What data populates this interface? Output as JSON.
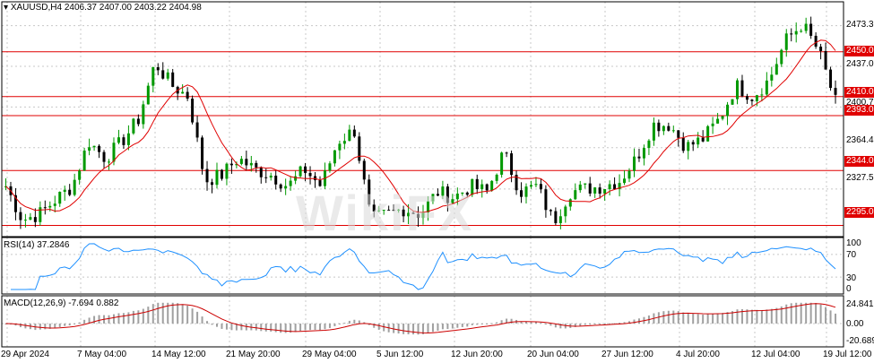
{
  "header": {
    "symbol_label": "XAUUSD,H4",
    "ohlc_text": "2406.37 2407.00 2403.22 2404.98"
  },
  "watermark": "WikiFX",
  "price_axis_labels": [
    "2473.30",
    "2437.00",
    "2400.70",
    "2364.40",
    "2327.55"
  ],
  "horizontal_levels": [
    {
      "label": "2450.00",
      "value": 2450.0
    },
    {
      "label": "2410.00",
      "value": 2410.0
    },
    {
      "label": "2393.00",
      "value": 2393.0
    },
    {
      "label": "2344.00",
      "value": 2344.0
    },
    {
      "label": "2295.00",
      "value": 2295.0
    }
  ],
  "rsi": {
    "title": "RSI(14) 37.2846",
    "axis_labels": [
      "100",
      "70",
      "30",
      "0"
    ]
  },
  "macd": {
    "title": "MACD(12,26,9) -7.694 0.882",
    "axis_labels": [
      "24.841",
      "0.00",
      "-20.689"
    ]
  },
  "date_labels": [
    "29 Apr 2024",
    "7 May 04:00",
    "14 May 12:00",
    "21 May 20:00",
    "29 May 04:00",
    "5 Jun 12:00",
    "12 Jun 20:00",
    "20 Jun 04:00",
    "27 Jun 12:00",
    "4 Jul 20:00",
    "12 Jul 04:00",
    "19 Jul 12:00"
  ],
  "colors": {
    "bull_candle": "#009900",
    "bear_candle": "#000000",
    "ma_line": "#e00000",
    "level_line": "#e00000",
    "rsi_line": "#1e90ff",
    "macd_hist": "#a0a0a0",
    "signal_line": "#cc0000",
    "grid": "#c8c8c8"
  },
  "chart_data": {
    "type": "candlestick",
    "symbol": "XAUUSD",
    "timeframe": "H4",
    "x_start": "29 Apr 2024",
    "x_end": "19 Jul 12:00",
    "close_anchors": [
      [
        "29 Apr 2024",
        2330
      ],
      [
        "1 May",
        2300
      ],
      [
        "3 May",
        2305
      ],
      [
        "7 May 04:00",
        2318
      ],
      [
        "9 May",
        2330
      ],
      [
        "10 May",
        2370
      ],
      [
        "13 May",
        2355
      ],
      [
        "14 May 12:00",
        2370
      ],
      [
        "16 May",
        2390
      ],
      [
        "20 May",
        2440
      ],
      [
        "21 May 20:00",
        2420
      ],
      [
        "22 May",
        2410
      ],
      [
        "23 May",
        2335
      ],
      [
        "24 May",
        2340
      ],
      [
        "28 May",
        2355
      ],
      [
        "29 May 04:00",
        2345
      ],
      [
        "30 May",
        2340
      ],
      [
        "31 May",
        2330
      ],
      [
        "3 Jun",
        2345
      ],
      [
        "4 Jun",
        2330
      ],
      [
        "5 Jun 12:00",
        2370
      ],
      [
        "6 Jun",
        2380
      ],
      [
        "7 Jun",
        2300
      ],
      [
        "10 Jun",
        2305
      ],
      [
        "12 Jun 20:00",
        2310
      ],
      [
        "13 Jun",
        2305
      ],
      [
        "14 Jun",
        2325
      ],
      [
        "17 Jun",
        2320
      ],
      [
        "18 Jun",
        2330
      ],
      [
        "19 Jun",
        2325
      ],
      [
        "20 Jun 04:00",
        2360
      ],
      [
        "21 Jun",
        2325
      ],
      [
        "24 Jun",
        2330
      ],
      [
        "26 Jun",
        2298
      ],
      [
        "27 Jun 12:00",
        2325
      ],
      [
        "28 Jun",
        2328
      ],
      [
        "1 Jul",
        2330
      ],
      [
        "2 Jul",
        2335
      ],
      [
        "3 Jul",
        2355
      ],
      [
        "4 Jul 20:00",
        2385
      ],
      [
        "5 Jul",
        2385
      ],
      [
        "8 Jul",
        2365
      ],
      [
        "9 Jul",
        2372
      ],
      [
        "10 Jul",
        2390
      ],
      [
        "11 Jul",
        2420
      ],
      [
        "12 Jul 04:00",
        2410
      ],
      [
        "15 Jul",
        2425
      ],
      [
        "16 Jul",
        2460
      ],
      [
        "17 Jul",
        2475
      ],
      [
        "18 Jul",
        2450
      ],
      [
        "19 Jul 12:00",
        2405
      ]
    ]
  }
}
